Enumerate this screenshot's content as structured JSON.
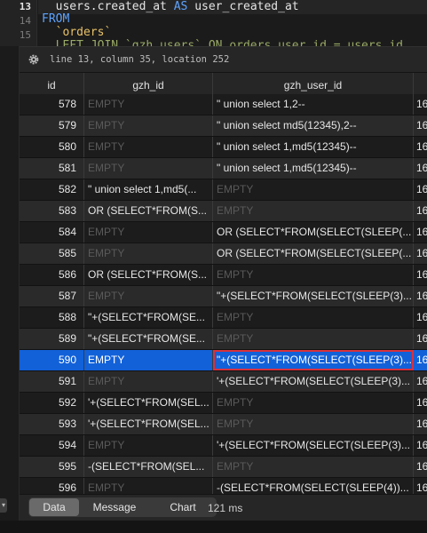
{
  "editor": {
    "line_numbers": [
      "13",
      "14",
      "15"
    ],
    "lines": [
      {
        "pre": "  users.created_at ",
        "kw": "AS",
        "post": " user_created_at"
      },
      {
        "pre": "",
        "kw": "FROM",
        "post": ""
      },
      {
        "pre": "  ",
        "str": "`orders`",
        "post": ""
      },
      {
        "pre": "  LEFT JOIN `gzh_users` ON orders.user_id = users.id",
        "kw": "",
        "post": ""
      }
    ]
  },
  "status": {
    "icon": "gear-icon",
    "text": "line 13, column 35, location 252"
  },
  "table": {
    "columns": [
      "id",
      "gzh_id",
      "gzh_user_id",
      ""
    ],
    "empty_label": "EMPTY",
    "rows": [
      {
        "id": "578",
        "gzh_id": "EMPTY",
        "gzh_user_id": "\" union select 1,2--",
        "x": "16"
      },
      {
        "id": "579",
        "gzh_id": "EMPTY",
        "gzh_user_id": "\" union select md5(12345),2--",
        "x": "16"
      },
      {
        "id": "580",
        "gzh_id": "EMPTY",
        "gzh_user_id": "\" union select 1,md5(12345)--",
        "x": "16"
      },
      {
        "id": "581",
        "gzh_id": "EMPTY",
        "gzh_user_id": "\" union select 1,md5(12345)--",
        "x": "16"
      },
      {
        "id": "582",
        "gzh_id": "\" union select 1,md5(...",
        "gzh_user_id": "EMPTY",
        "x": "16"
      },
      {
        "id": "583",
        "gzh_id": " OR (SELECT*FROM(S...",
        "gzh_user_id": "EMPTY",
        "x": "16"
      },
      {
        "id": "584",
        "gzh_id": "EMPTY",
        "gzh_user_id": " OR (SELECT*FROM(SELECT(SLEEP(...",
        "x": "16"
      },
      {
        "id": "585",
        "gzh_id": "EMPTY",
        "gzh_user_id": " OR (SELECT*FROM(SELECT(SLEEP(...",
        "x": "16"
      },
      {
        "id": "586",
        "gzh_id": " OR (SELECT*FROM(S...",
        "gzh_user_id": "EMPTY",
        "x": "16"
      },
      {
        "id": "587",
        "gzh_id": "EMPTY",
        "gzh_user_id": "\"+(SELECT*FROM(SELECT(SLEEP(3)...",
        "x": "16"
      },
      {
        "id": "588",
        "gzh_id": "\"+(SELECT*FROM(SE...",
        "gzh_user_id": "EMPTY",
        "x": "16"
      },
      {
        "id": "589",
        "gzh_id": "\"+(SELECT*FROM(SE...",
        "gzh_user_id": "EMPTY",
        "x": "16"
      },
      {
        "id": "590",
        "gzh_id": "EMPTY",
        "gzh_user_id": "\"+(SELECT*FROM(SELECT(SLEEP(3)...",
        "x": "16",
        "selected": true
      },
      {
        "id": "591",
        "gzh_id": "EMPTY",
        "gzh_user_id": "'+(SELECT*FROM(SELECT(SLEEP(3)...",
        "x": "16"
      },
      {
        "id": "592",
        "gzh_id": "'+(SELECT*FROM(SEL...",
        "gzh_user_id": "EMPTY",
        "x": "16"
      },
      {
        "id": "593",
        "gzh_id": "'+(SELECT*FROM(SEL...",
        "gzh_user_id": "EMPTY",
        "x": "16"
      },
      {
        "id": "594",
        "gzh_id": "EMPTY",
        "gzh_user_id": "'+(SELECT*FROM(SELECT(SLEEP(3)...",
        "x": "16"
      },
      {
        "id": "595",
        "gzh_id": "-(SELECT*FROM(SEL...",
        "gzh_user_id": "EMPTY",
        "x": "16"
      },
      {
        "id": "596",
        "gzh_id": "EMPTY",
        "gzh_user_id": "-(SELECT*FROM(SELECT(SLEEP(4))...",
        "x": "16"
      }
    ]
  },
  "bottom": {
    "tabs": [
      "Data",
      "Message",
      "Chart"
    ],
    "active_tab": "Data",
    "timing": "121 ms"
  },
  "colors": {
    "selection": "#1261d8",
    "focus_outline": "#d8323c",
    "keyword": "#5ea4ff",
    "string": "#e8c268"
  }
}
